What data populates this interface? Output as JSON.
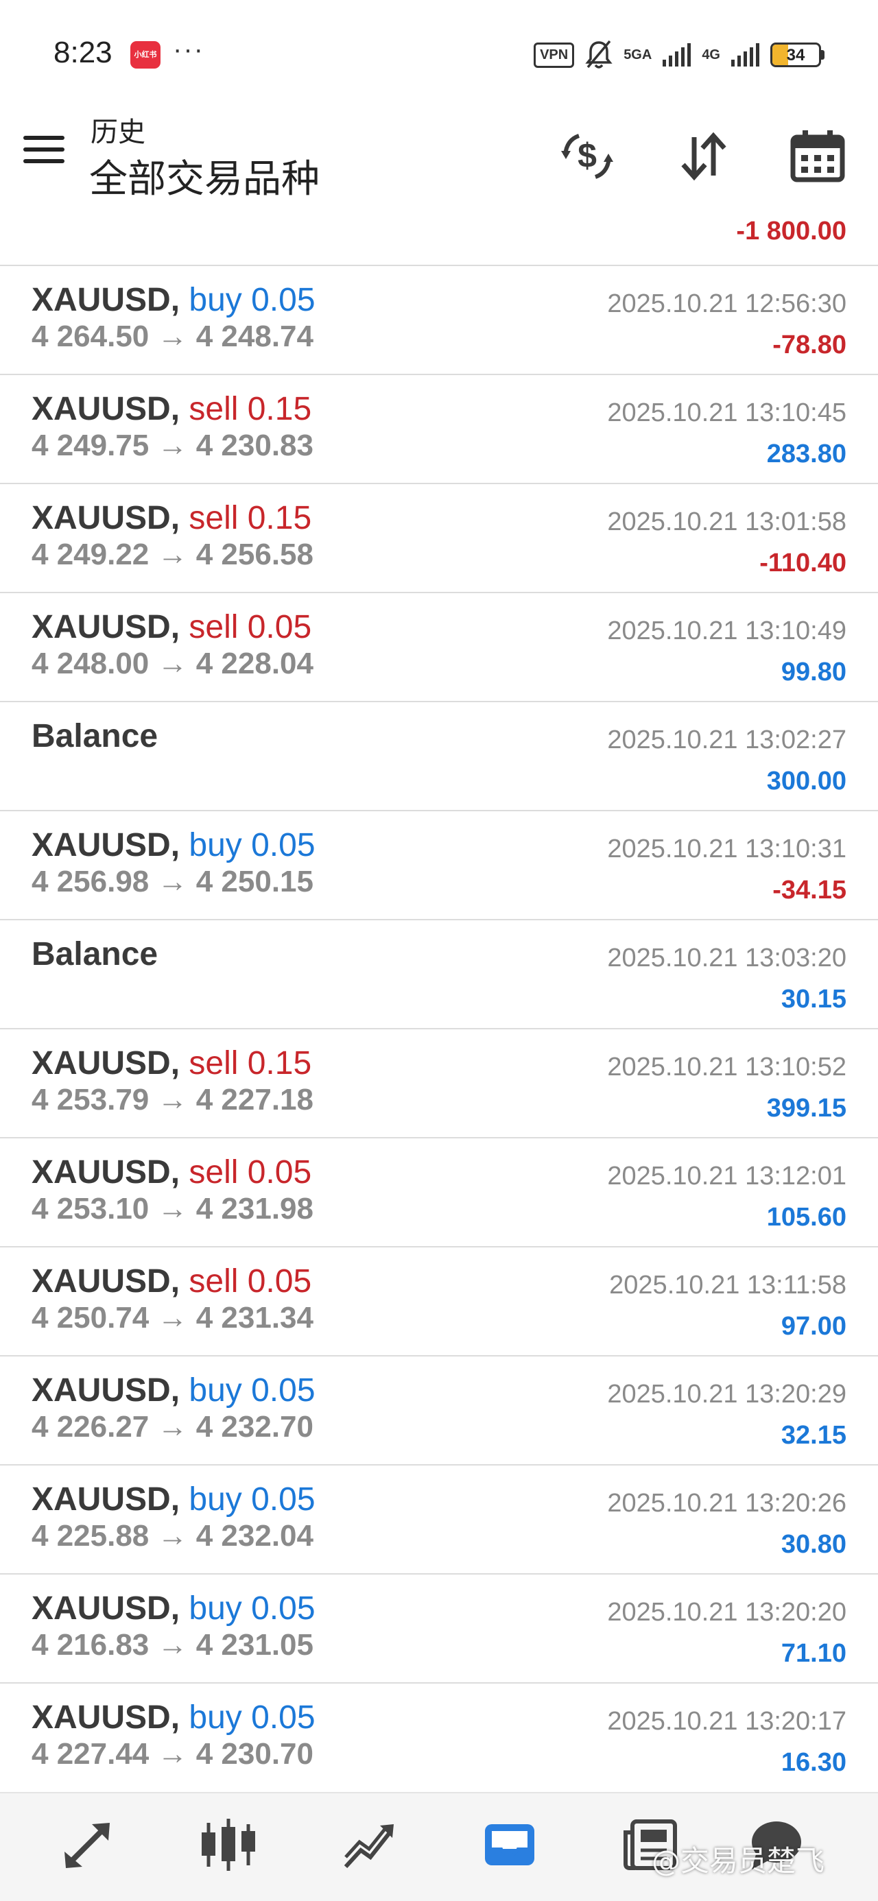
{
  "status_bar": {
    "time": "8:23",
    "app_badge": "小红书",
    "more": "···",
    "vpn": "VPN",
    "net1": "5GA",
    "net2": "4G",
    "battery": "34",
    "battery_level": 0.34
  },
  "header": {
    "subtitle": "历史",
    "title": "全部交易品种"
  },
  "total": "-1 800.00",
  "colors": {
    "buy": "#1b78d8",
    "sell": "#c8262b",
    "positive": "#1b78d8",
    "negative": "#c8262b"
  },
  "rows": [
    {
      "symbol": "XAUUSD,",
      "side": "buy 0.05",
      "prices": "4 264.50 → 4 248.74",
      "time": "2025.10.21 12:56:30",
      "profit": "-78.80"
    },
    {
      "symbol": "XAUUSD,",
      "side": "sell 0.15",
      "prices": "4 249.75 → 4 230.83",
      "time": "2025.10.21 13:10:45",
      "profit": "283.80"
    },
    {
      "symbol": "XAUUSD,",
      "side": "sell 0.15",
      "prices": "4 249.22 → 4 256.58",
      "time": "2025.10.21 13:01:58",
      "profit": "-110.40"
    },
    {
      "symbol": "XAUUSD,",
      "side": "sell 0.05",
      "prices": "4 248.00 → 4 228.04",
      "time": "2025.10.21 13:10:49",
      "profit": "99.80"
    },
    {
      "label": "Balance",
      "time": "2025.10.21 13:02:27",
      "profit": "300.00"
    },
    {
      "symbol": "XAUUSD,",
      "side": "buy 0.05",
      "prices": "4 256.98 → 4 250.15",
      "time": "2025.10.21 13:10:31",
      "profit": "-34.15"
    },
    {
      "label": "Balance",
      "time": "2025.10.21 13:03:20",
      "profit": "30.15"
    },
    {
      "symbol": "XAUUSD,",
      "side": "sell 0.15",
      "prices": "4 253.79 → 4 227.18",
      "time": "2025.10.21 13:10:52",
      "profit": "399.15"
    },
    {
      "symbol": "XAUUSD,",
      "side": "sell 0.05",
      "prices": "4 253.10 → 4 231.98",
      "time": "2025.10.21 13:12:01",
      "profit": "105.60"
    },
    {
      "symbol": "XAUUSD,",
      "side": "sell 0.05",
      "prices": "4 250.74 → 4 231.34",
      "time": "2025.10.21 13:11:58",
      "profit": "97.00"
    },
    {
      "symbol": "XAUUSD,",
      "side": "buy 0.05",
      "prices": "4 226.27 → 4 232.70",
      "time": "2025.10.21 13:20:29",
      "profit": "32.15"
    },
    {
      "symbol": "XAUUSD,",
      "side": "buy 0.05",
      "prices": "4 225.88 → 4 232.04",
      "time": "2025.10.21 13:20:26",
      "profit": "30.80"
    },
    {
      "symbol": "XAUUSD,",
      "side": "buy 0.05",
      "prices": "4 216.83 → 4 231.05",
      "time": "2025.10.21 13:20:20",
      "profit": "71.10"
    },
    {
      "symbol": "XAUUSD,",
      "side": "buy 0.05",
      "prices": "4 227.44 → 4 230.70",
      "time": "2025.10.21 13:20:17",
      "profit": "16.30"
    }
  ],
  "bottom_nav": {
    "items": [
      "quotes-icon",
      "chart-icon",
      "trade-icon",
      "history-icon",
      "news-icon",
      "messages-icon"
    ],
    "active": "history-icon"
  },
  "watermark": "@交易员楚飞"
}
